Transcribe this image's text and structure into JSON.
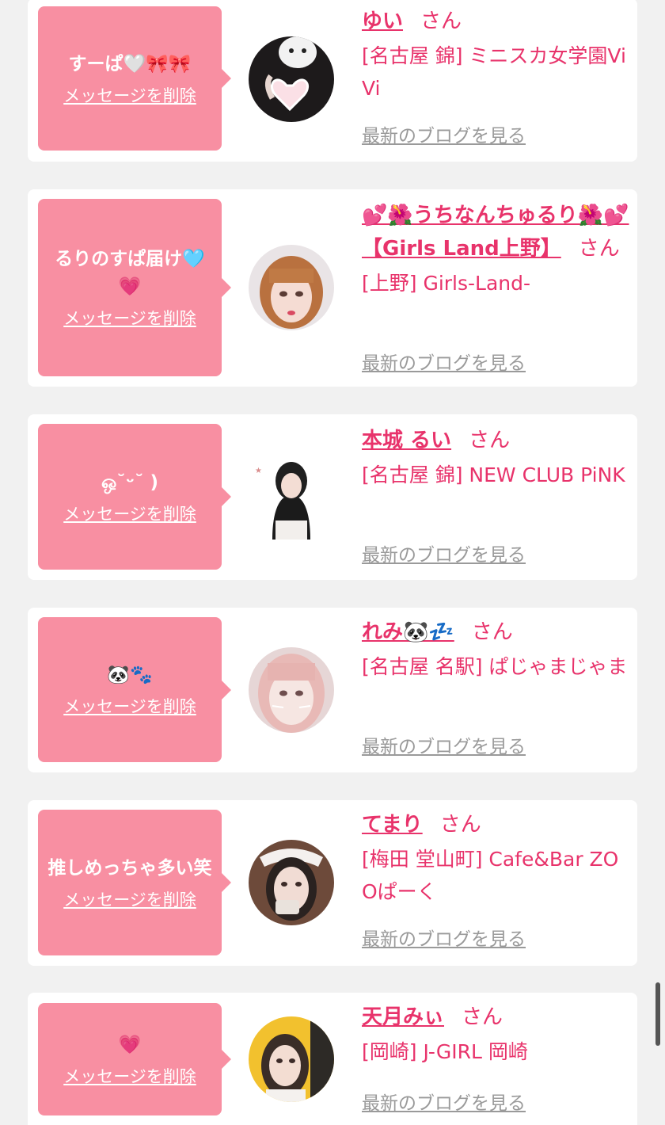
{
  "colors": {
    "page_bg": "#f1f1f1",
    "bubble": "#f88fa2",
    "accent": "#e8336b",
    "muted_link": "#9a9a9a"
  },
  "delete_label": "メッセージを削除",
  "san_label": "さん",
  "blog_label": "最新のブログを見る",
  "items": [
    {
      "message": "すーぱ🤍🎀🎀",
      "name": "ゆい",
      "shop": "[名古屋 錦] ミニスカ女学園ViVi",
      "avatar": "cat-heart-avatar"
    },
    {
      "message": "るりのすぱ届け🩵💗",
      "name": "💕🌺うちなんちゅるり🌺💕【Girls Land上野】",
      "shop": "[上野] Girls-Land-",
      "avatar": "woman-orange-hair-avatar"
    },
    {
      "message": "ஒ˘ᵕ˘ )",
      "name": "本城 るい",
      "shop": "[名古屋 錦] NEW CLUB PiNK",
      "avatar": "woman-black-hair-avatar"
    },
    {
      "message": "🐼🐾",
      "name": "れみ🐼💤",
      "shop": "[名古屋 名駅] ぱじゃまじゃま",
      "avatar": "woman-pink-hair-cat-filter-avatar"
    },
    {
      "message": "推しめっちゃ多い笑",
      "name": "てまり",
      "shop": "[梅田 堂山町] Cafe&Bar ZOOぱーく",
      "avatar": "woman-maid-headband-avatar"
    },
    {
      "message": "💗",
      "name": "天月みぃ",
      "shop": "[岡崎] J-GIRL 岡崎",
      "avatar": "woman-yellow-poster-avatar"
    }
  ]
}
